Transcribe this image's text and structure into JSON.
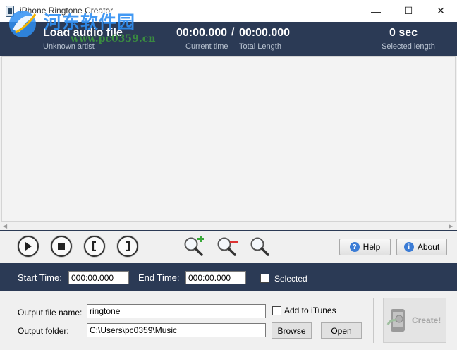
{
  "window": {
    "title": "iPhone Ringtone Creator",
    "minimize": "—",
    "maximize": "☐",
    "close": "✕"
  },
  "watermark": {
    "line1": "河东软件园",
    "line2": "www.pc0359.cn"
  },
  "header": {
    "title": "Load audio file",
    "artist": "Unknown artist",
    "current_time": "00:00.000",
    "separator": "/",
    "total_length": "00:00.000",
    "current_time_label": "Current time",
    "total_length_label": "Total Length",
    "selected_length": "0 sec",
    "selected_length_label": "Selected length"
  },
  "controls": {
    "help_label": "Help",
    "about_label": "About"
  },
  "timebar": {
    "start_label": "Start Time:",
    "start_value": "000:00.000",
    "end_label": "End Time:",
    "end_value": "000:00.000",
    "selected_label": "Selected"
  },
  "output": {
    "file_name_label": "Output file name:",
    "file_name_value": "ringtone",
    "add_itunes_label": "Add to iTunes",
    "folder_label": "Output folder:",
    "folder_value": "C:\\Users\\pc0359\\Music",
    "browse_label": "Browse",
    "open_label": "Open",
    "create_label": "Create!"
  },
  "colors": {
    "header_bg": "#2b3a55",
    "accent": "#3a7bd5"
  }
}
